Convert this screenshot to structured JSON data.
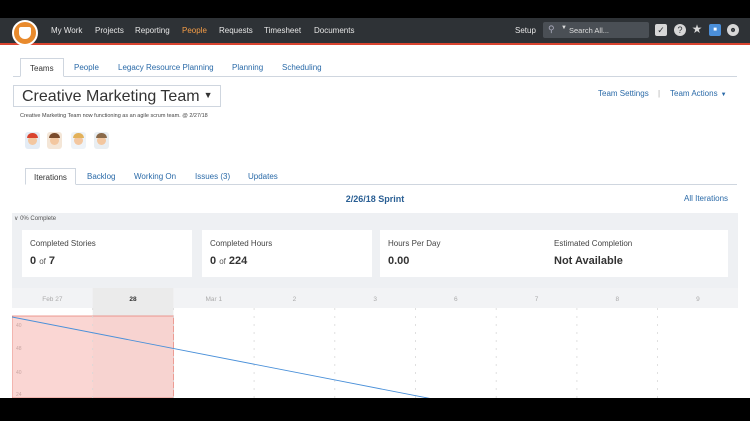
{
  "topnav": {
    "items": [
      {
        "label": "My Work",
        "active": false
      },
      {
        "label": "Projects",
        "active": false
      },
      {
        "label": "Reporting",
        "active": false
      },
      {
        "label": "People",
        "active": true
      },
      {
        "label": "Requests",
        "active": false
      },
      {
        "label": "Timesheet",
        "active": false
      },
      {
        "label": "Documents",
        "active": false
      }
    ],
    "setup_label": "Setup",
    "search_placeholder": "Search All...",
    "accent_color": "#f49c46",
    "bar_color": "#2e3236"
  },
  "tabs": [
    {
      "label": "Teams",
      "active": true
    },
    {
      "label": "People",
      "active": false
    },
    {
      "label": "Legacy Resource Planning",
      "active": false
    },
    {
      "label": "Planning",
      "active": false
    },
    {
      "label": "Scheduling",
      "active": false
    }
  ],
  "team": {
    "title": "Creative Marketing Team",
    "description": "Creative Marketing Team now functioning as an agile scrum team. @ 2/27/18",
    "settings_label": "Team Settings",
    "separator": "|",
    "actions_label": "Team Actions"
  },
  "subtabs": [
    {
      "label": "Iterations",
      "active": true
    },
    {
      "label": "Backlog",
      "active": false
    },
    {
      "label": "Working On",
      "active": false
    },
    {
      "label": "Issues (3)",
      "active": false
    },
    {
      "label": "Updates",
      "active": false
    }
  ],
  "sprint": {
    "title": "2/26/18 Sprint",
    "all_iterations_label": "All Iterations",
    "complete_toggle": "0% Complete"
  },
  "stats": {
    "completed_stories": {
      "label": "Completed Stories",
      "value": "0",
      "of": "of",
      "total": "7"
    },
    "completed_hours": {
      "label": "Completed Hours",
      "value": "0",
      "of": "of",
      "total": "224"
    },
    "hours_per_day": {
      "label": "Hours Per Day",
      "value": "0.00"
    },
    "estimated_completion": {
      "label": "Estimated Completion",
      "value": "Not Available"
    }
  },
  "burndown": {
    "dates": [
      "Feb 27",
      "28",
      "Mar 1",
      "2",
      "3",
      "6",
      "7",
      "8",
      "9"
    ],
    "today_index": 1,
    "y_ticks": [
      "40",
      "48",
      "40",
      "24"
    ],
    "ideal_color": "#4a90d9",
    "past_region_color": "#f9cfcb"
  }
}
